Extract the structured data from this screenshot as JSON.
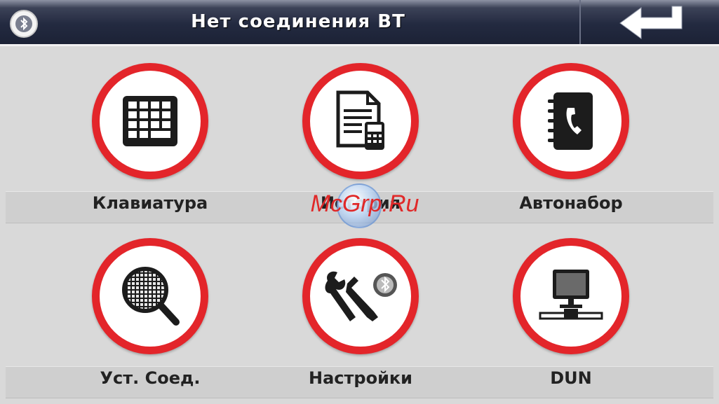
{
  "header": {
    "title": "Нет соединения BT",
    "bluetooth_icon": "bluetooth-icon",
    "back_icon": "back-arrow-icon"
  },
  "menu": {
    "items": [
      {
        "label": "Клавиатура",
        "icon": "keypad-icon"
      },
      {
        "label": "История",
        "icon": "history-icon"
      },
      {
        "label": "Автонабор",
        "icon": "phonebook-icon"
      },
      {
        "label": "Уст. Соед.",
        "icon": "search-icon"
      },
      {
        "label": "Настройки",
        "icon": "settings-tools-icon"
      },
      {
        "label": "DUN",
        "icon": "network-computer-icon"
      }
    ]
  },
  "watermark": {
    "text": "McGrp.Ru"
  },
  "colors": {
    "accent": "#e3252a",
    "header": "#232a40",
    "background": "#d9d9d9"
  }
}
